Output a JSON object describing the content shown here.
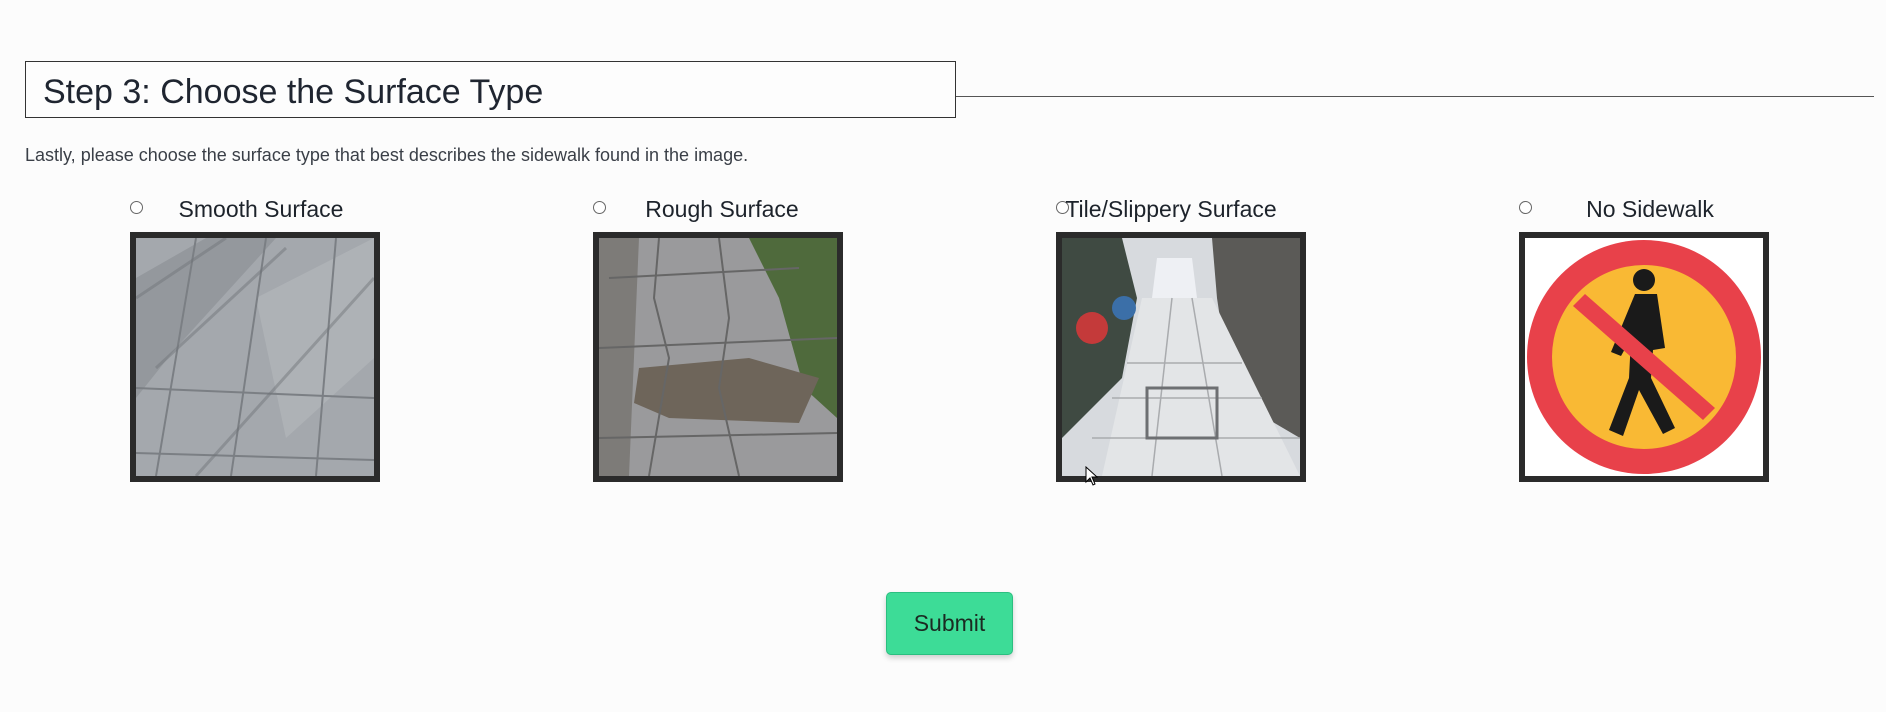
{
  "header": {
    "title": "Step 3: Choose the Surface Type"
  },
  "instructions": "Lastly, please choose the surface type that best describes the sidewalk found in the image.",
  "options": [
    {
      "label": "Smooth Surface",
      "image": "smooth-sidewalk-photo",
      "selected": false
    },
    {
      "label": "Rough Surface",
      "image": "cracked-sidewalk-photo",
      "selected": false
    },
    {
      "label": "Tile/Slippery Surface",
      "image": "tiled-alley-photo",
      "selected": false
    },
    {
      "label": "No Sidewalk",
      "image": "no-pedestrians-sign-icon",
      "selected": false
    }
  ],
  "submit_label": "Submit",
  "colors": {
    "submit_bg": "#3ddc97",
    "thumb_border": "#2b2b2b",
    "sign_red": "#e8414a",
    "sign_yellow": "#f9b934"
  }
}
